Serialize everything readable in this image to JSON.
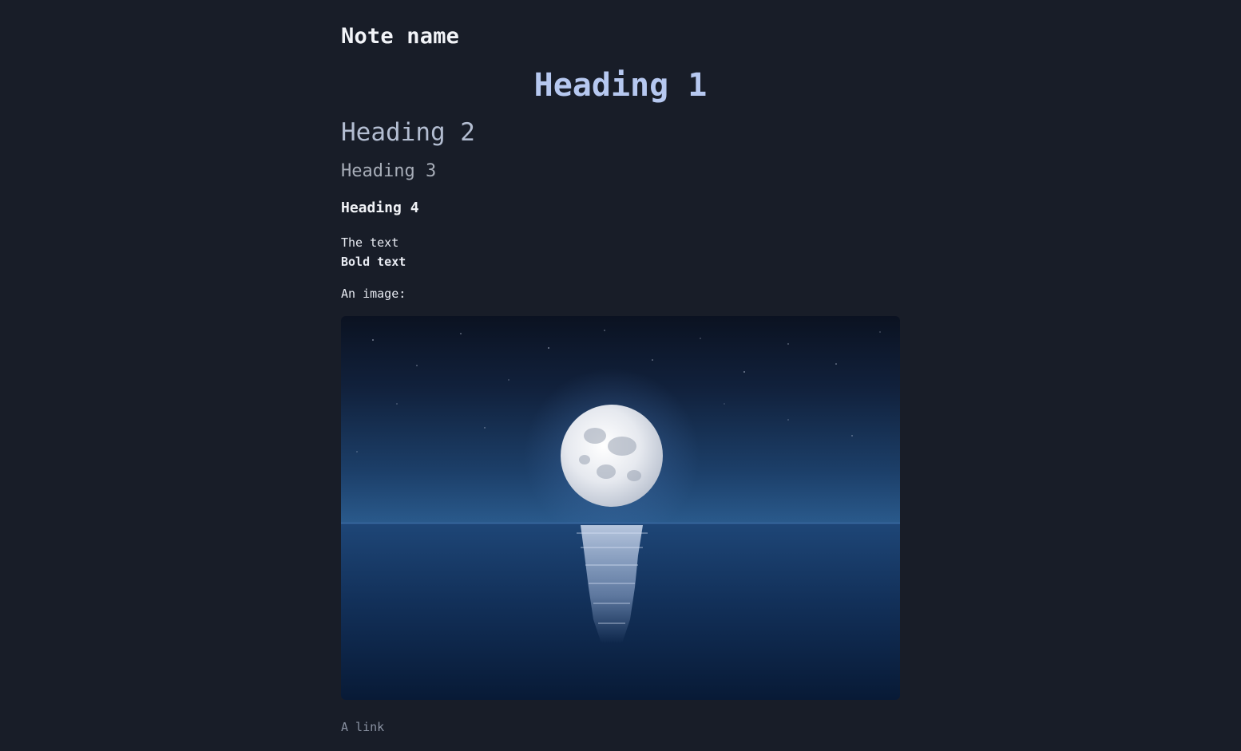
{
  "note": {
    "title": "Note name",
    "heading1": "Heading 1",
    "heading2": "Heading 2",
    "heading3": "Heading 3",
    "heading4": "Heading 4",
    "text_line": "The text",
    "bold_line": "Bold text",
    "image_label": "An image:",
    "image_subject": "moonlit-sea-photo",
    "link_text": "A link"
  },
  "colors": {
    "background": "#181d28",
    "heading1": "#b6c8f0",
    "heading2": "#b3bdd1",
    "heading3": "#a7adb8",
    "link": "#8a92a2"
  }
}
